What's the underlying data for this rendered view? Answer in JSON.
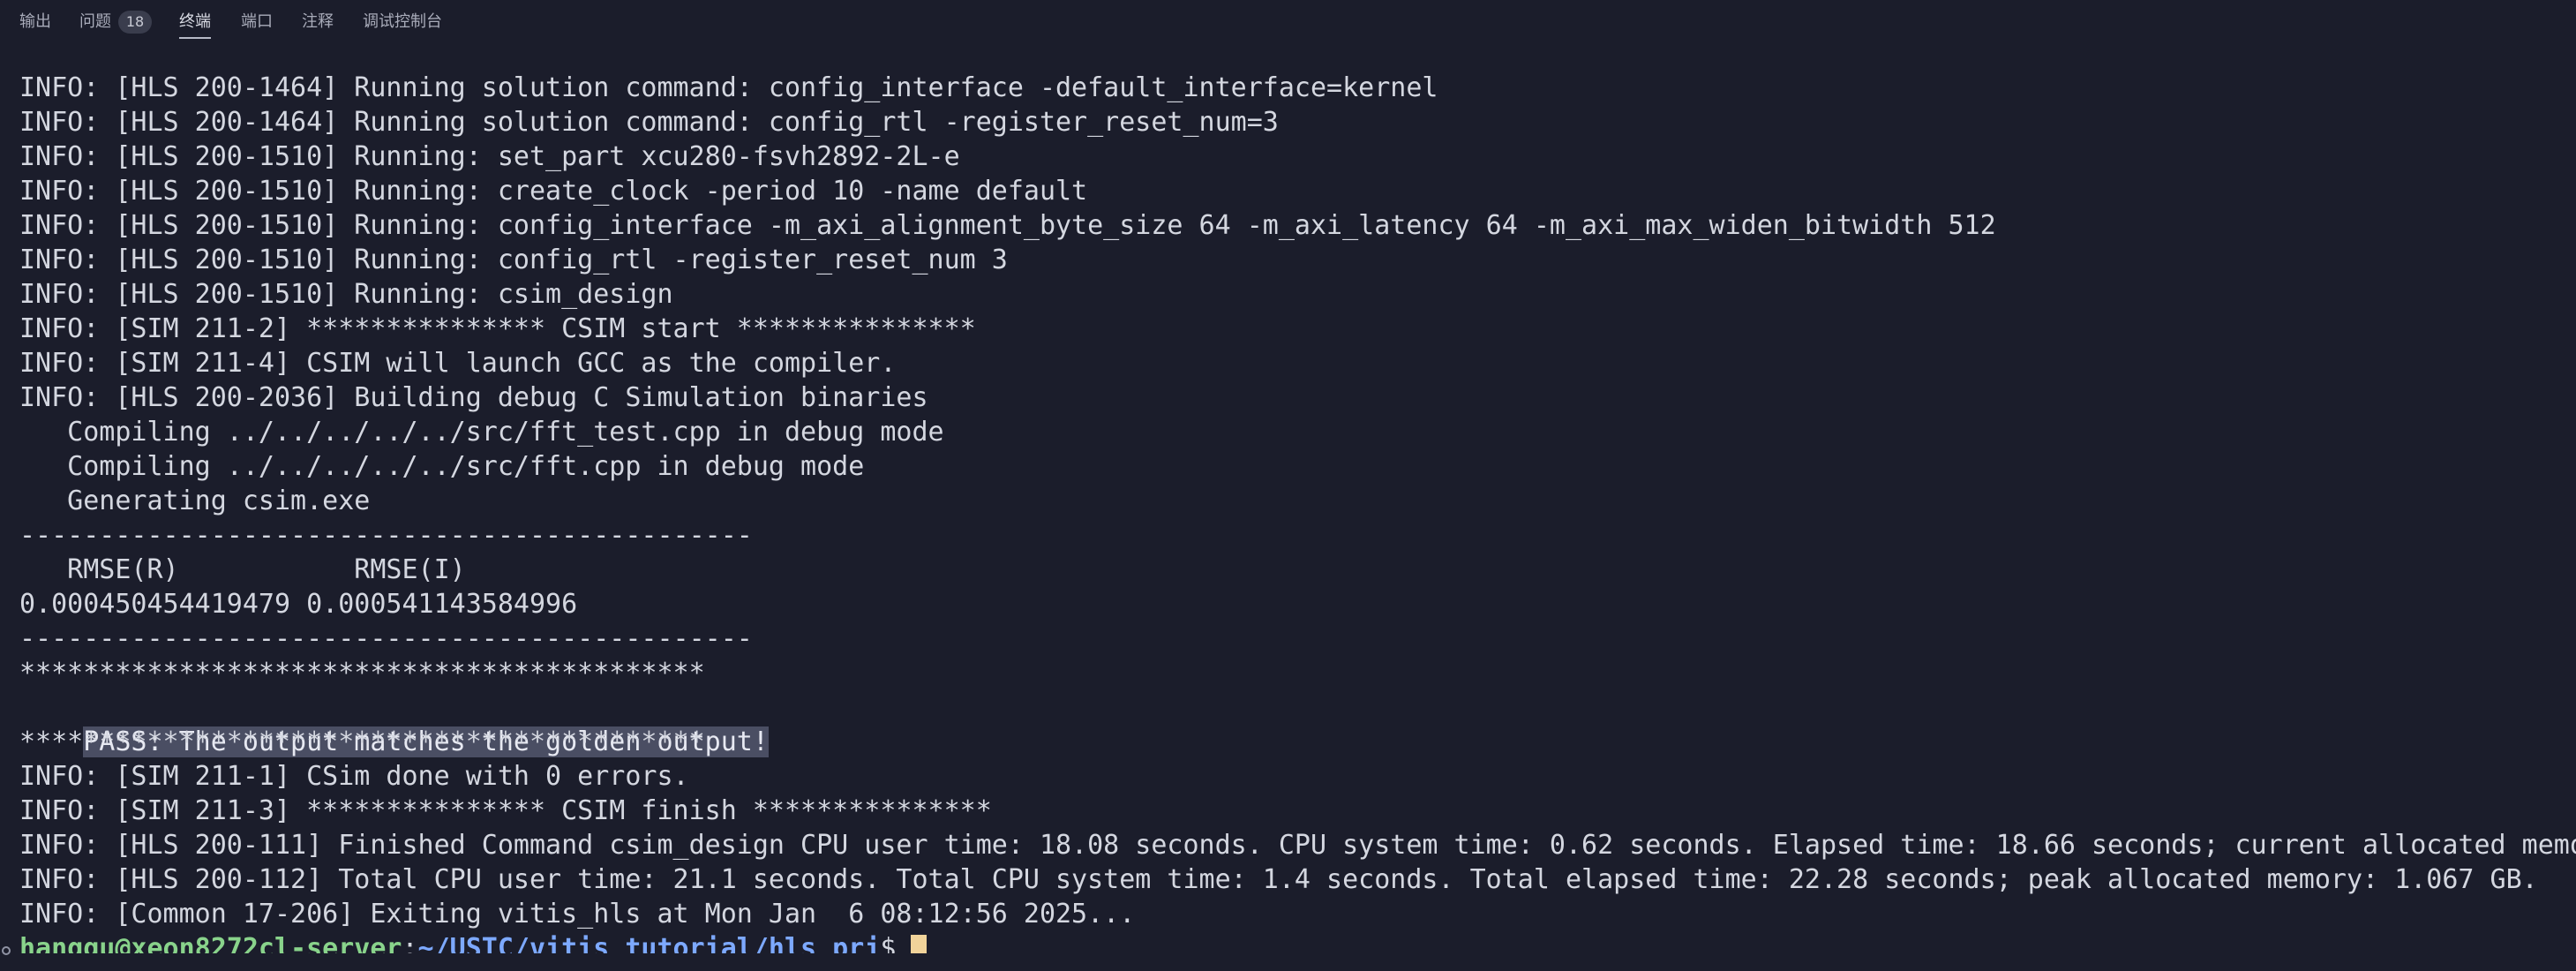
{
  "panel": {
    "tabs": [
      {
        "label": "输出"
      },
      {
        "label": "问题",
        "badge": "18"
      },
      {
        "label": "终端",
        "active": true
      },
      {
        "label": "端口"
      },
      {
        "label": "注释"
      },
      {
        "label": "调试控制台"
      }
    ]
  },
  "terminal": {
    "lines": [
      "INFO: [HLS 200-1464] Running solution command: config_interface -default_interface=kernel",
      "INFO: [HLS 200-1464] Running solution command: config_rtl -register_reset_num=3",
      "INFO: [HLS 200-1510] Running: set_part xcu280-fsvh2892-2L-e",
      "INFO: [HLS 200-1510] Running: create_clock -period 10 -name default",
      "INFO: [HLS 200-1510] Running: config_interface -m_axi_alignment_byte_size 64 -m_axi_latency 64 -m_axi_max_widen_bitwidth 512",
      "INFO: [HLS 200-1510] Running: config_rtl -register_reset_num 3",
      "INFO: [HLS 200-1510] Running: csim_design",
      "INFO: [SIM 211-2] *************** CSIM start ***************",
      "INFO: [SIM 211-4] CSIM will launch GCC as the compiler.",
      "INFO: [HLS 200-2036] Building debug C Simulation binaries",
      "   Compiling ../../../../../src/fft_test.cpp in debug mode",
      "   Compiling ../../../../../src/fft.cpp in debug mode",
      "   Generating csim.exe",
      "----------------------------------------------",
      "   RMSE(R)           RMSE(I)",
      "0.000450454419479 0.000541143584996",
      "----------------------------------------------",
      "*******************************************",
      "PASS: The output matches the golden output!",
      "*******************************************",
      "INFO: [SIM 211-1] CSim done with 0 errors.",
      "INFO: [SIM 211-3] *************** CSIM finish ***************",
      "INFO: [HLS 200-111] Finished Command csim_design CPU user time: 18.08 seconds. CPU system time: 0.62 seconds. Elapsed time: 18.66 seconds; current allocated memo",
      "INFO: [HLS 200-112] Total CPU user time: 21.1 seconds. Total CPU system time: 1.4 seconds. Total elapsed time: 22.28 seconds; peak allocated memory: 1.067 GB.",
      "INFO: [Common 17-206] Exiting vitis_hls at Mon Jan  6 08:12:56 2025..."
    ],
    "prompt": {
      "user_host": "hanggu@xeon8272cl-server",
      "colon": ":",
      "path": "~/USTC/vitis_tutorial/hls_prj",
      "dollar": "$"
    }
  }
}
